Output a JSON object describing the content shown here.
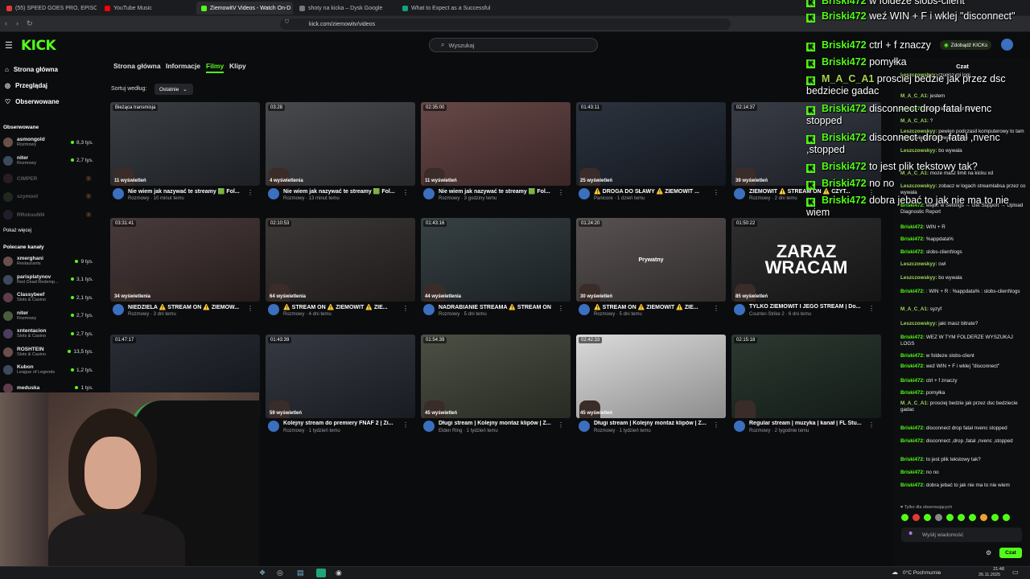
{
  "browser": {
    "tabs": [
      {
        "label": "(55) SPEED GOES PRO, EPISODE 5 ft",
        "color": "#e53935"
      },
      {
        "label": "YouTube Music",
        "color": "#ff0000"
      },
      {
        "label": "ZiemowitV Videos - Watch On-D",
        "color": "#53fc18"
      },
      {
        "label": "shoty na kicka – Dysk Google",
        "color": "#777777"
      },
      {
        "label": "What to Expect as a Successful Strea",
        "color": "#10a37f"
      }
    ],
    "url": "kick.com/ziemowitv/videos"
  },
  "header": {
    "logo": "KICK",
    "search_placeholder": "Wyszukaj",
    "get_kicks": "Zdobądź KICKs"
  },
  "sidebar": {
    "nav": [
      {
        "label": "Strona główna",
        "icon": "home-icon"
      },
      {
        "label": "Przeglądaj",
        "icon": "compass-icon"
      },
      {
        "label": "Obserwowane",
        "icon": "heart-icon"
      }
    ],
    "followed_title": "Obserwowane",
    "followed": [
      {
        "name": "asmongold",
        "category": "Rozmowy",
        "viewers": "8,3 tys.",
        "live": true
      },
      {
        "name": "niter",
        "category": "Rozmowy",
        "viewers": "2,7 tys.",
        "live": true
      },
      {
        "name": "CIMPER",
        "category": "",
        "viewers": "",
        "live": false
      },
      {
        "name": "szymool",
        "category": "",
        "viewers": "",
        "live": false
      },
      {
        "name": "RRobsoNN",
        "category": "",
        "viewers": "",
        "live": false
      }
    ],
    "show_more": "Pokaż więcej",
    "recommended_title": "Polecane kanały",
    "recommended": [
      {
        "name": "xmerghani",
        "category": "Restaurants",
        "viewers": "9 tys."
      },
      {
        "name": "parisplatynov",
        "category": "Red Dead Redemp...",
        "viewers": "3,1 tys."
      },
      {
        "name": "Classybeef",
        "category": "Slots & Casino",
        "viewers": "2,1 tys."
      },
      {
        "name": "niter",
        "category": "Rozmowy",
        "viewers": "2,7 tys."
      },
      {
        "name": "xntentacion",
        "category": "Slots & Casino",
        "viewers": "2,7 tys."
      },
      {
        "name": "ROSHTEIN",
        "category": "Slots & Casino",
        "viewers": "13,5 tys."
      },
      {
        "name": "Kubon",
        "category": "League of Legends",
        "viewers": "1,2 tys."
      },
      {
        "name": "meduska",
        "category": "",
        "viewers": "1 tys."
      }
    ]
  },
  "content": {
    "tabs": [
      "Strona główna",
      "Informacje",
      "Filmy",
      "Klipy"
    ],
    "active_tab": "Filmy",
    "sort_label": "Sortuj według:",
    "sort_value": "Ostatnie",
    "videos": [
      {
        "duration": "Bieżąca transmisja",
        "views": "11 wyświetleń",
        "title": "Nie wiem jak nazywać te streamy 🟩 Fol...",
        "sub": "Rozmowy · 10 minut temu",
        "bg": "#2c3036"
      },
      {
        "duration": "03:28",
        "views": "4 wyświetlenia",
        "title": "Nie wiem jak nazywać te streamy 🟩 Fol...",
        "sub": "Rozmowy · 13 minut temu",
        "bg": "#3a3c40"
      },
      {
        "duration": "02:35:00",
        "views": "11 wyświetleń",
        "title": "Nie wiem jak nazywać te streamy 🟩 Fol...",
        "sub": "Rozmowy · 3 godziny temu",
        "bg": "#5b3a3a"
      },
      {
        "duration": "01:43:11",
        "views": "25 wyświetleń",
        "title": "⚠️ DROGA DO SŁAWY ⚠️ ZIEMOWIT ...",
        "sub": "Panicore · 1 dzień temu",
        "bg": "#1d2430"
      },
      {
        "duration": "02:14:37",
        "views": "39 wyświetleń",
        "title": "ZIEMOWIT ⚠️ STREAM ON ⚠️ CZYT...",
        "sub": "Rozmowy · 2 dni temu",
        "bg": "#2a2e38"
      },
      {
        "duration": "03:31:41",
        "views": "34 wyświetlenia",
        "title": "NIEDZIELA ⚠️ STREAM ON ⚠️ ZIEMOW...",
        "sub": "Rozmowy · 3 dni temu",
        "bg": "#3b2c2c"
      },
      {
        "duration": "02:10:53",
        "views": "64 wyświetlenia",
        "title": "⚠️ STREAM ON ⚠️ ZIEMOWIT ⚠️ ZIE...",
        "sub": "Rozmowy · 4 dni temu",
        "bg": "#2f2929"
      },
      {
        "duration": "01:43:16",
        "views": "44 wyświetlenia",
        "title": "NADRABIANIE STREAMA ⚠️ STREAM ON",
        "sub": "Rozmowy · 5 dni temu",
        "bg": "#283236"
      },
      {
        "duration": "01:24:20",
        "views": "30 wyświetleń",
        "title": "⚠️ STREAM ON ⚠️ ZIEMOWIT ⚠️ ZIE...",
        "sub": "Rozmowy · 5 dni temu",
        "bg": "#4b4444",
        "overlay": "Prywatny"
      },
      {
        "duration": "01:50:22",
        "views": "85 wyświetleń",
        "title": "TYLKO ZIEMOWIT I JEGO STREAM | Do...",
        "sub": "Counter-Strike 2 · 6 dni temu",
        "bg": "#1f1f1f",
        "overlay": "ZARAZ WRACAM"
      },
      {
        "duration": "01:47:17",
        "views": "",
        "title": "",
        "sub": "",
        "bg": "#1a1d26"
      },
      {
        "duration": "01:43:39",
        "views": "59 wyświetleń",
        "title": "Kolejny stream do premiery FNAF 2 | Zi...",
        "sub": "Rozmowy · 1 tydzień temu",
        "bg": "#262a33"
      },
      {
        "duration": "01:54:39",
        "views": "45 wyświetleń",
        "title": "Długi stream | Kolejny montaż klipów | Z...",
        "sub": "Elden Ring · 1 tydzień temu",
        "bg": "#3e4236"
      },
      {
        "duration": "02:42:33",
        "views": "45 wyświetleń",
        "title": "Długi stream | Kolejny montaż klipów | Z...",
        "sub": "Rozmowy · 1 tydzień temu",
        "bg": "#d8d8d8"
      },
      {
        "duration": "02:15:18",
        "views": "",
        "title": "Regular stream | muzyka | kanał | FL Stu...",
        "sub": "Rozmowy · 2 tygodnie temu",
        "bg": "#1d2a22"
      }
    ]
  },
  "chat": {
    "title": "Czat",
    "messages": [
      {
        "user": "Leszczowskyy:",
        "text": "rzucisz mi logi",
        "c": "u2"
      },
      {
        "user": "M_A_C_A1:",
        "text": "jestem",
        "c": "u2"
      },
      {
        "user": "Briski472:",
        "text": "ndoa kiedy masz wolny",
        "c": "u"
      },
      {
        "user": "M_A_C_A1:",
        "text": "?",
        "c": "u2"
      },
      {
        "user": "Leszczowskyy:",
        "text": "pewien podczasil komputerowy to tam wyrzyrwijesz i u wywala zjebie",
        "c": "u2"
      },
      {
        "user": "Leszczowskyy:",
        "text": "bo wywala",
        "c": "u2"
      },
      {
        "user": "M_A_C_A1:",
        "text": "moze masz limit na kicku xd",
        "c": "u2"
      },
      {
        "user": "Leszczowskyy:",
        "text": "zobacz w logach streamlabsa przez co wywala",
        "c": "u2"
      },
      {
        "user": "Briski472:",
        "text": "wejdź w Settings → Get Support → Upload Diagnostic Report",
        "c": "u"
      },
      {
        "user": "Briski472:",
        "text": "WIN + R",
        "c": "u"
      },
      {
        "user": "Briski472:",
        "text": "%appdata%",
        "c": "u"
      },
      {
        "user": "Briski472:",
        "text": "slobs-client\\logs",
        "c": "u"
      },
      {
        "user": "Leszczowskyy:",
        "text": "cwl",
        "c": "u2"
      },
      {
        "user": "Leszczowskyy:",
        "text": "bo wywala",
        "c": "u2"
      },
      {
        "user": "Briski472:",
        "text": ": WIN + R : %appdata% : slobs-client\\logs",
        "c": "u"
      },
      {
        "user": "M_A_C_A1:",
        "text": "syzyf",
        "c": "u2"
      },
      {
        "user": "Leszczowskyy:",
        "text": "jaki masz bitrate?",
        "c": "u2"
      },
      {
        "user": "Briski472:",
        "text": "WEZ W TYM FOLDERZE WYSZUKAJ LOGS",
        "c": "u"
      },
      {
        "user": "Briski472:",
        "text": "w foldeze slobs-client",
        "c": "u"
      },
      {
        "user": "Briski472:",
        "text": "weź WIN + F i wklej \"disconnect\"",
        "c": "u"
      },
      {
        "user": "Briski472:",
        "text": "ctrl + f znaczy",
        "c": "u"
      },
      {
        "user": "Briski472:",
        "text": "pomyłka",
        "c": "u"
      },
      {
        "user": "M_A_C_A1:",
        "text": "prosciej bedzie jak przez dsc bedziecie gadac",
        "c": "u2"
      },
      {
        "user": "Briski472:",
        "text": "disconnect drop fatal nvenc stopped",
        "c": "u"
      },
      {
        "user": "Briski472:",
        "text": "disconnect ,drop ,fatal ,nvenc ,stopped",
        "c": "u"
      },
      {
        "user": "Briski472:",
        "text": "to jest plik tekstowy tak?",
        "c": "u"
      },
      {
        "user": "Briski472:",
        "text": "no no",
        "c": "u"
      },
      {
        "user": "Briski472:",
        "text": "dobra jebać to jak nie ma to nie wiem",
        "c": "u"
      }
    ],
    "followers_only": "Tylko dla obserwujących",
    "input_placeholder": "Wyślij wiadomość",
    "send_label": "Czat"
  },
  "overlay_chat": [
    {
      "user": "Briski472",
      "text": "w foldeze slobs-client",
      "c": "u"
    },
    {
      "user": "Briski472",
      "text": "weź WIN + F i wklej \"disconnect\"",
      "c": "u"
    },
    {
      "user": "Briski472",
      "text": "ctrl + f znaczy",
      "c": "u"
    },
    {
      "user": "Briski472",
      "text": "pomyłka",
      "c": "u"
    },
    {
      "user": "M_A_C_A1",
      "text": "prosciej bedzie jak przez dsc bedziecie gadac",
      "c": "u2"
    },
    {
      "user": "Briski472",
      "text": "disconnect drop fatal nvenc stopped",
      "c": "u"
    },
    {
      "user": "Briski472",
      "text": "disconnect ,drop ,fatal ,nvenc ,stopped",
      "c": "u"
    },
    {
      "user": "Briski472",
      "text": "to jest plik tekstowy tak?",
      "c": "u"
    },
    {
      "user": "Briski472",
      "text": "no no",
      "c": "u"
    },
    {
      "user": "Briski472",
      "text": "dobra jebać to jak nie ma to nie wiem",
      "c": "u"
    }
  ],
  "taskbar": {
    "weather": "0°C  Pochmurnie",
    "time": "21:48",
    "date": "26.11.2025"
  }
}
